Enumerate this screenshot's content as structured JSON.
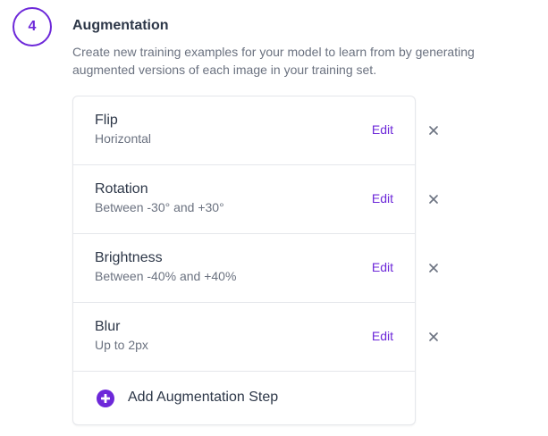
{
  "step": {
    "number": "4",
    "title": "Augmentation",
    "description": "Create new training examples for your model to learn from by generating augmented versions of each image in your training set."
  },
  "augmentations": [
    {
      "title": "Flip",
      "detail": "Horizontal",
      "edit_label": "Edit"
    },
    {
      "title": "Rotation",
      "detail": "Between -30° and +30°",
      "edit_label": "Edit"
    },
    {
      "title": "Brightness",
      "detail": "Between -40% and +40%",
      "edit_label": "Edit"
    },
    {
      "title": "Blur",
      "detail": "Up to 2px",
      "edit_label": "Edit"
    }
  ],
  "add_step": {
    "label": "Add Augmentation Step",
    "icon": "plus-circle-icon"
  },
  "remove_icon": "close-icon",
  "colors": {
    "accent": "#6d28d9",
    "muted_text": "#6b7280",
    "border": "#e5e7eb"
  }
}
